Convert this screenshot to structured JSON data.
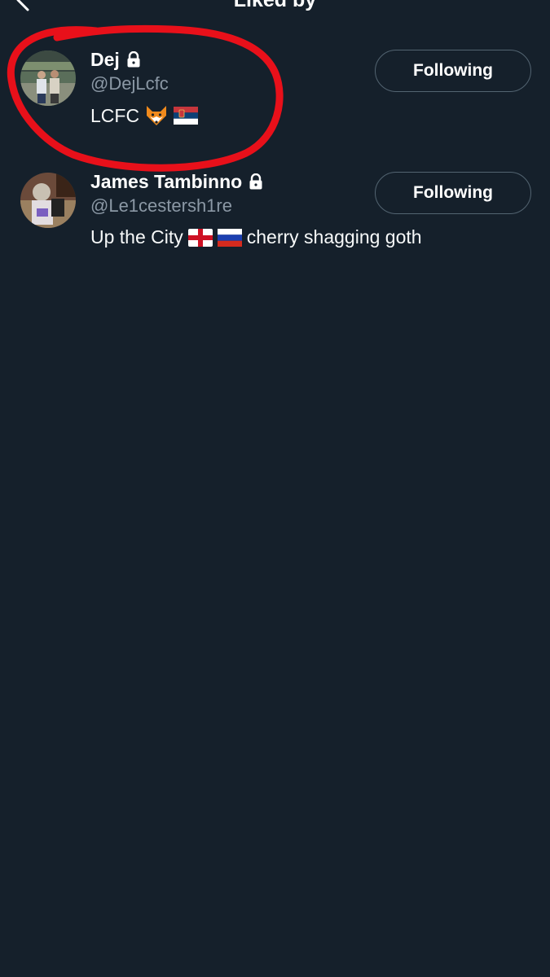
{
  "header": {
    "title": "Liked by",
    "back_icon": "back-arrow-icon"
  },
  "users": [
    {
      "display_name": "Dej",
      "protected_icon": "lock-icon",
      "handle": "@DejLcfc",
      "bio_text": "LCFC",
      "bio_emoji": [
        "fox-emoji",
        "serbia-flag-emoji"
      ],
      "follow_label": "Following"
    },
    {
      "display_name": "James Tambinno",
      "protected_icon": "lock-icon",
      "handle": "@Le1cestersh1re",
      "bio_prefix": "Up the City",
      "bio_emoji": [
        "england-flag-emoji",
        "russia-flag-emoji"
      ],
      "bio_suffix": "cherry shagging goth",
      "follow_label": "Following"
    }
  ],
  "colors": {
    "background": "#15202b",
    "text_primary": "#ffffff",
    "text_secondary": "#8b98a5",
    "button_border": "#536471",
    "annotation": "#e8101a"
  }
}
